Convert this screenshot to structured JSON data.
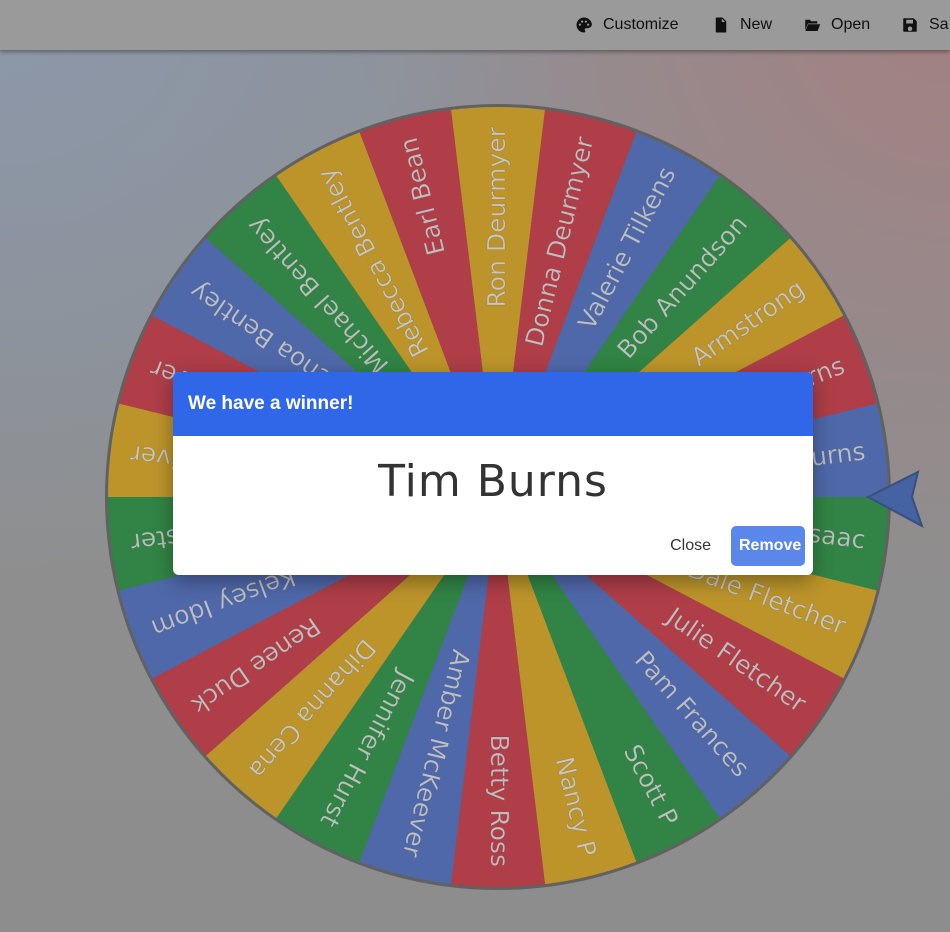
{
  "toolbar": {
    "customize_label": "Customize",
    "new_label": "New",
    "open_label": "Open",
    "save_label": "Sa"
  },
  "wheel": {
    "entries": [
      "Ron Deurmyer",
      "Donna Deurmyer",
      "Valerie Tilkens",
      "Bob Anundson",
      "Armstrong",
      "Tim Burns",
      "Tim Burns",
      "Isaac",
      "Dale Fletcher",
      "Julie Fletcher",
      "Pam Frances",
      "Scott P",
      "Nancy P",
      "Betty Ross",
      "Amber McKeever",
      "Jennifer Hurst",
      "Dihanna Cena",
      "Renee Duck",
      "Kelsey Idom",
      "Sylvester",
      "Oliver",
      "Oliver",
      "Renoa Bentley",
      "Michael Bentley",
      "Rebecca Bentley",
      "Earl Bean"
    ],
    "colors": [
      "#e0a400",
      "#cc1f2f",
      "#3a60c4",
      "#0c8a2a"
    ],
    "pointer_icon": "triangle-pointer-icon"
  },
  "dialog": {
    "title": "We have a winner!",
    "winner": "Tim Burns",
    "close_label": "Close",
    "remove_label": "Remove"
  }
}
